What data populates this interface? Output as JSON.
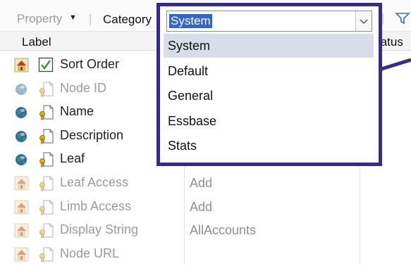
{
  "toolbar": {
    "property_label": "Property",
    "category_label": "Category"
  },
  "columns": {
    "label": "Label",
    "status_partial": "tatus"
  },
  "category_select": {
    "value": "System",
    "options": [
      "System",
      "Default",
      "General",
      "Essbase",
      "Stats"
    ]
  },
  "rows": [
    {
      "label": "Sort Order",
      "value": "",
      "enabled": true,
      "type_icon": "home-icon",
      "item_icon": "checkbox-icon"
    },
    {
      "label": "Node ID",
      "value": "",
      "enabled": false,
      "type_icon": "globe-icon",
      "item_icon": "key-document-icon"
    },
    {
      "label": "Name",
      "value": "",
      "enabled": true,
      "type_icon": "globe-icon",
      "item_icon": "key-document-icon"
    },
    {
      "label": "Description",
      "value": "",
      "enabled": true,
      "type_icon": "globe-icon",
      "item_icon": "key-document-icon"
    },
    {
      "label": "Leaf",
      "value": "",
      "enabled": true,
      "type_icon": "globe-icon",
      "item_icon": "key-document-icon"
    },
    {
      "label": "Leaf Access",
      "value": "Add",
      "enabled": false,
      "type_icon": "home-icon",
      "item_icon": "key-document-icon"
    },
    {
      "label": "Limb Access",
      "value": "Add",
      "enabled": false,
      "type_icon": "home-icon",
      "item_icon": "key-document-icon"
    },
    {
      "label": "Display String",
      "value": "AllAccounts",
      "enabled": false,
      "type_icon": "home-icon",
      "item_icon": "key-document-icon"
    },
    {
      "label": "Node URL",
      "value": "",
      "enabled": false,
      "type_icon": "home-icon",
      "item_icon": "key-document-icon"
    }
  ],
  "colors": {
    "highlight_frame": "#332c90",
    "selection": "#3366cc",
    "selected_item": "#d9dde9"
  }
}
